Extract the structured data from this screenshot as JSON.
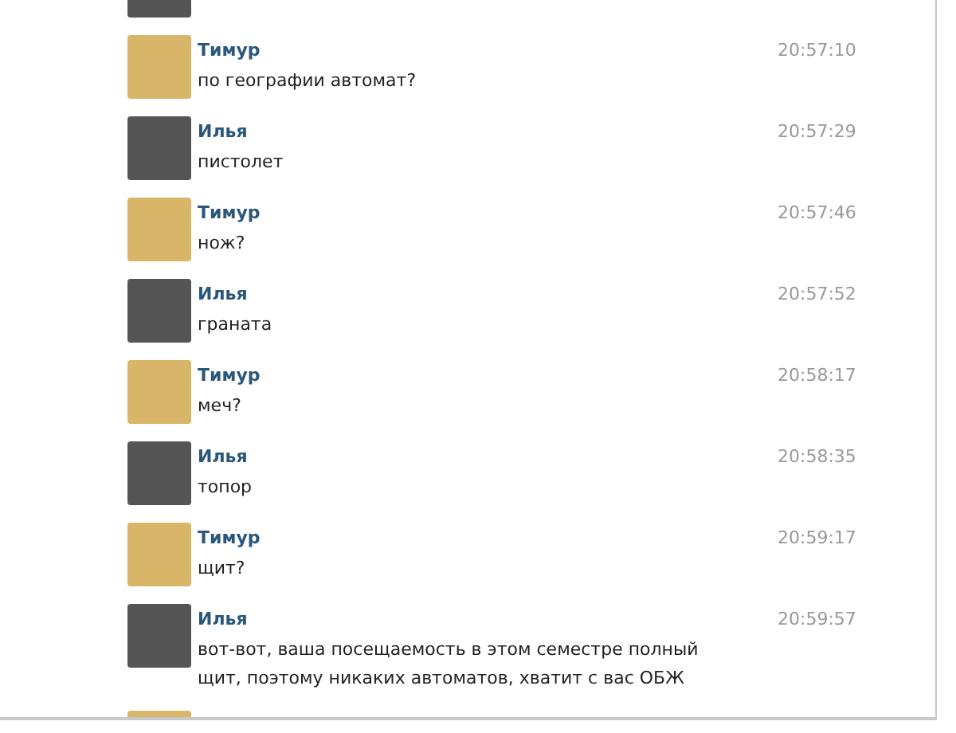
{
  "messages": [
    {
      "kind": "partial",
      "color": "#555555"
    },
    {
      "kind": "message",
      "color": "#d9b56a",
      "author": "Тимур",
      "time": "20:57:10",
      "text": "по географии автомат?"
    },
    {
      "kind": "message",
      "color": "#555555",
      "author": "Илья",
      "time": "20:57:29",
      "text": "пистолет"
    },
    {
      "kind": "message",
      "color": "#d9b56a",
      "author": "Тимур",
      "time": "20:57:46",
      "text": "нож?"
    },
    {
      "kind": "message",
      "color": "#555555",
      "author": "Илья",
      "time": "20:57:52",
      "text": "граната"
    },
    {
      "kind": "message",
      "color": "#d9b56a",
      "author": "Тимур",
      "time": "20:58:17",
      "text": "меч?"
    },
    {
      "kind": "message",
      "color": "#555555",
      "author": "Илья",
      "time": "20:58:35",
      "text": "топор"
    },
    {
      "kind": "message",
      "color": "#d9b56a",
      "author": "Тимур",
      "time": "20:59:17",
      "text": "щит?"
    },
    {
      "kind": "message",
      "color": "#555555",
      "author": "Илья",
      "time": "20:59:57",
      "text": "вот-вот, ваша посещаемость в этом семестре полный щит, поэтому никаких автоматов, хватит с вас ОБЖ"
    },
    {
      "kind": "partial",
      "color": "#d9b56a"
    }
  ]
}
